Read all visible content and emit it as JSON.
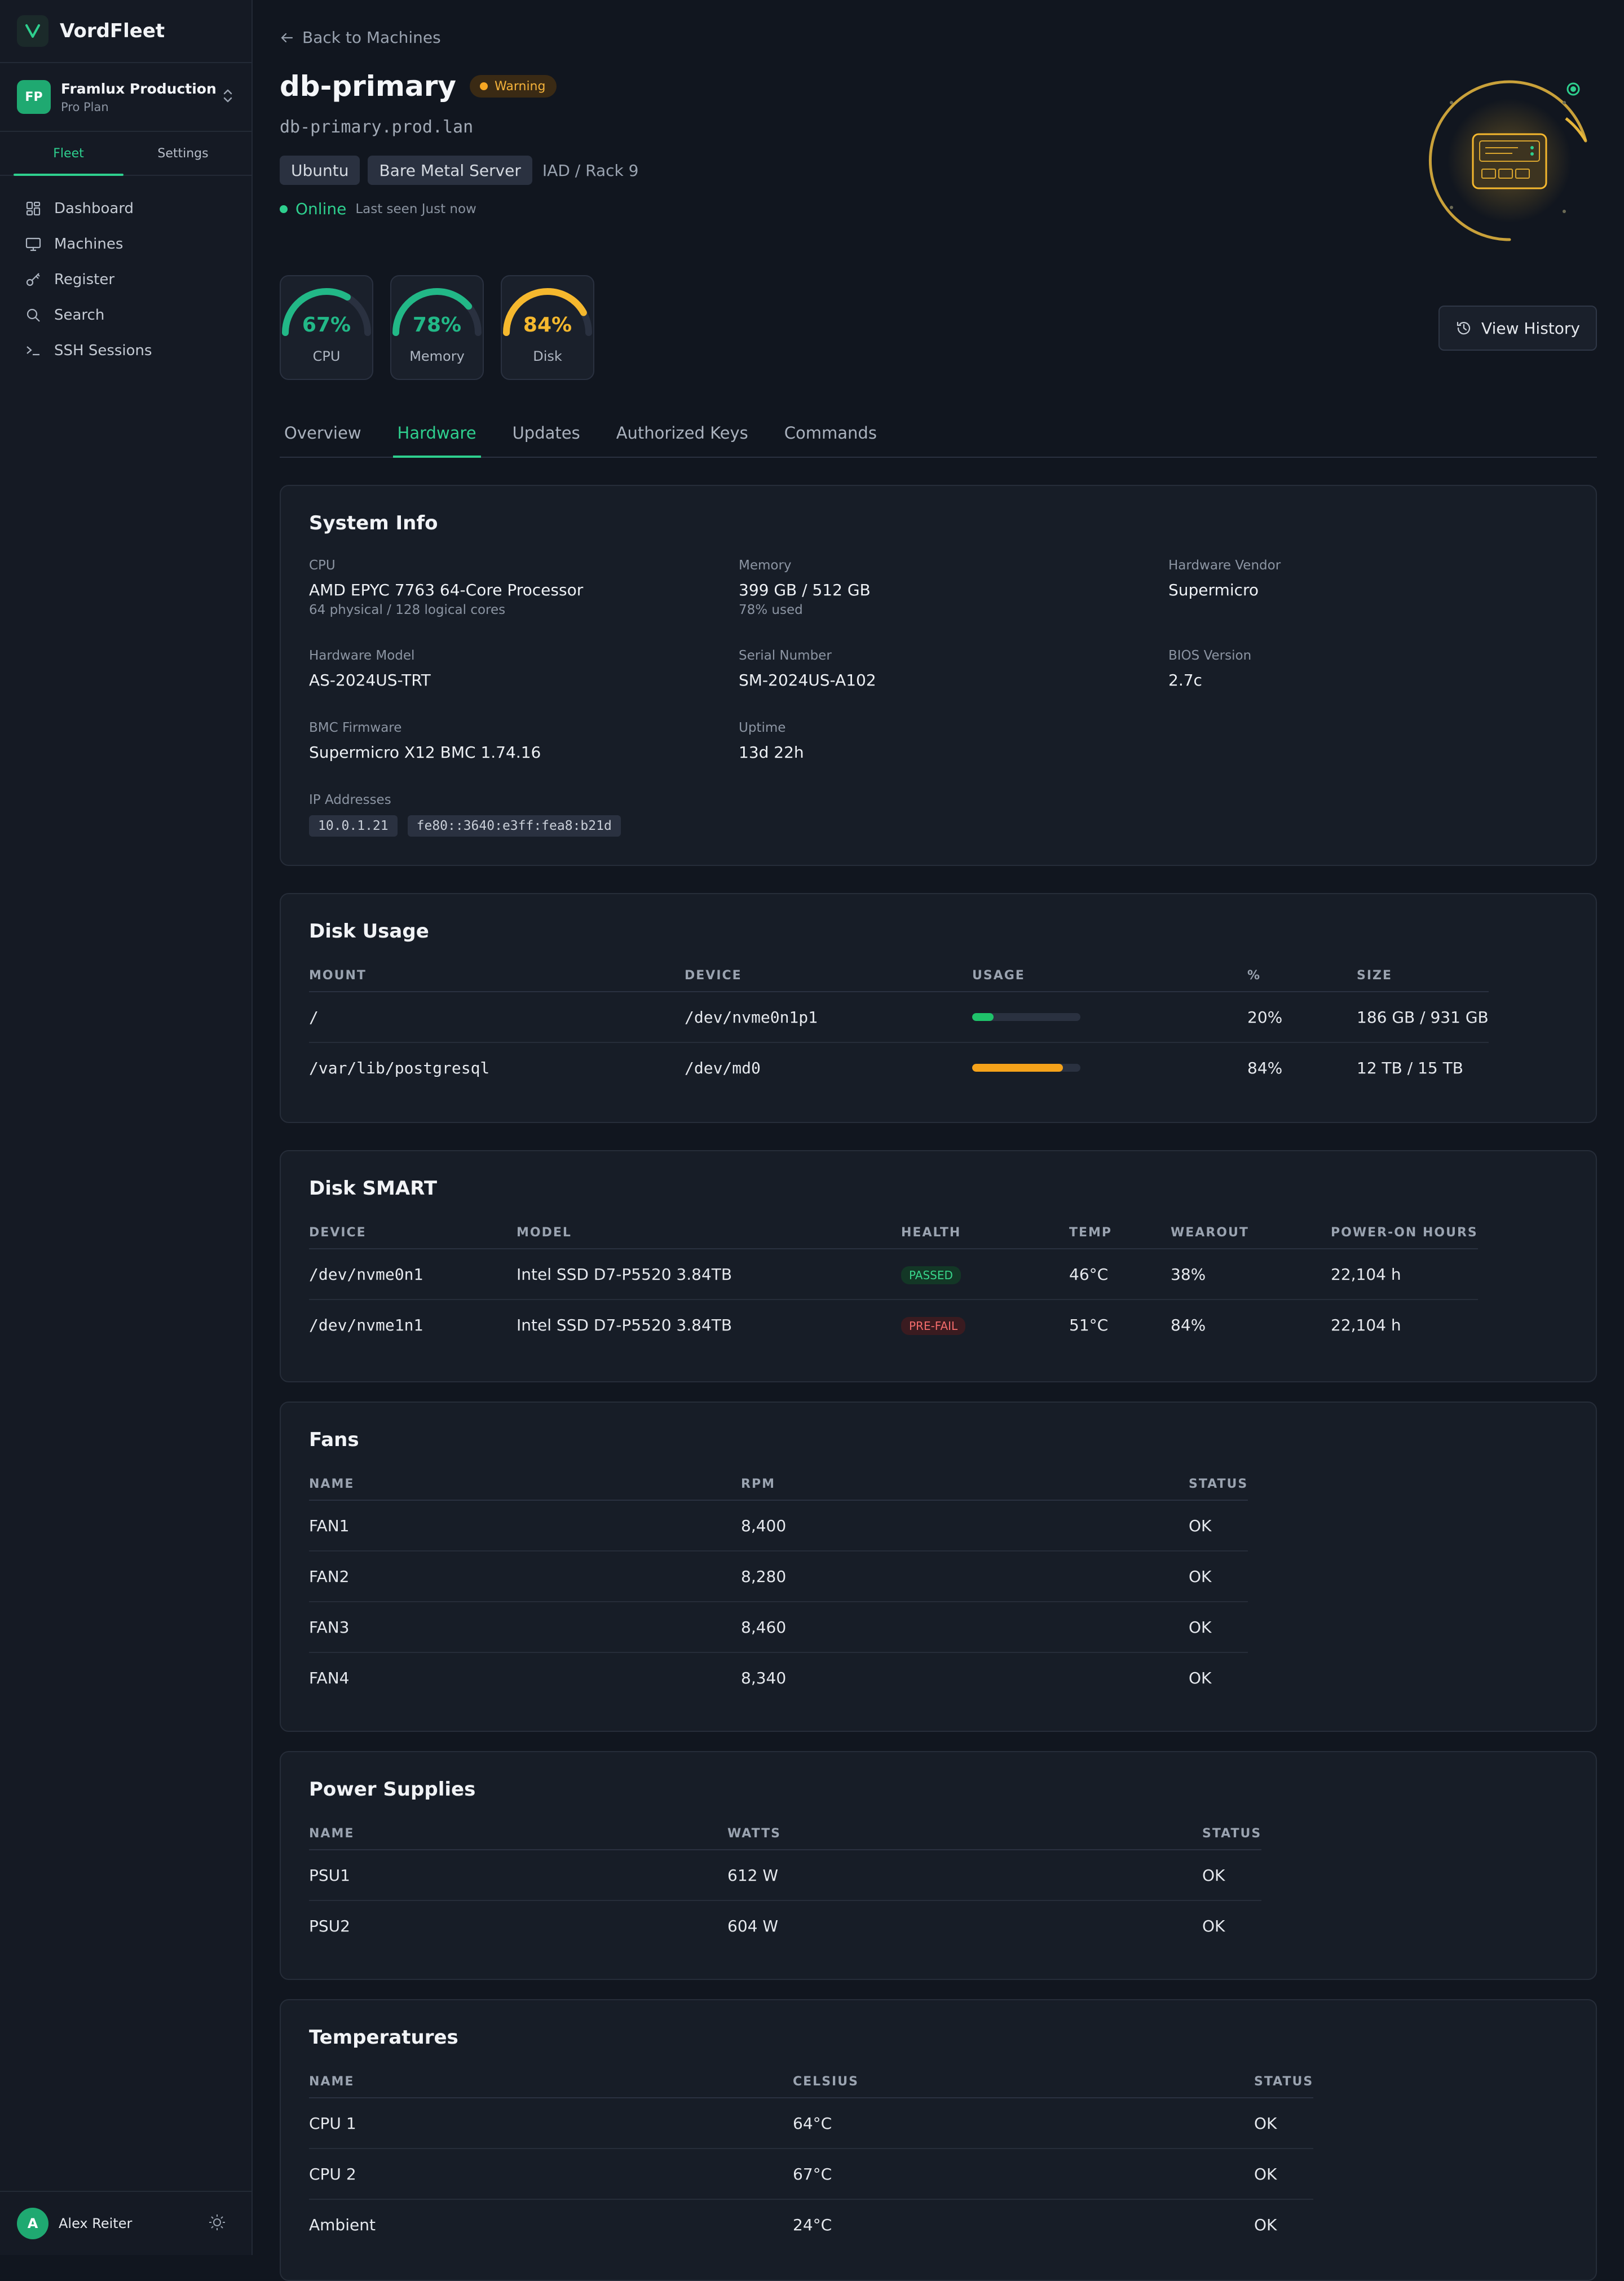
{
  "app": {
    "name": "VordFleet"
  },
  "org": {
    "initials": "FP",
    "name": "Framlux Production",
    "plan": "Pro Plan"
  },
  "sidebar": {
    "tabs": [
      {
        "label": "Fleet"
      },
      {
        "label": "Settings"
      }
    ],
    "items": [
      {
        "label": "Dashboard",
        "icon": "dashboard-icon"
      },
      {
        "label": "Machines",
        "icon": "monitor-icon"
      },
      {
        "label": "Register",
        "icon": "key-icon"
      },
      {
        "label": "Search",
        "icon": "search-icon"
      },
      {
        "label": "SSH Sessions",
        "icon": "terminal-icon"
      }
    ]
  },
  "user": {
    "initial": "A",
    "name": "Alex Reiter"
  },
  "header": {
    "back_label": "Back to Machines",
    "title": "db-primary",
    "status_badge": "Warning",
    "hostname": "db-primary.prod.lan",
    "chips": [
      "Ubuntu",
      "Bare Metal Server"
    ],
    "location": "IAD / Rack 9",
    "online": "Online",
    "last_seen": "Last seen Just now",
    "history_label": "View History"
  },
  "gauges": [
    {
      "value": "67%",
      "label": "CPU",
      "percent": 67,
      "color": "#22b887"
    },
    {
      "value": "78%",
      "label": "Memory",
      "percent": 78,
      "color": "#22b887"
    },
    {
      "value": "84%",
      "label": "Disk",
      "percent": 84,
      "color": "#f5b82e"
    }
  ],
  "tabs": [
    "Overview",
    "Hardware",
    "Updates",
    "Authorized Keys",
    "Commands"
  ],
  "active_tab": "Hardware",
  "system_info": {
    "title": "System Info",
    "cpu_label": "CPU",
    "cpu_value": "AMD EPYC 7763 64-Core Processor",
    "cpu_sub": "64 physical / 128 logical cores",
    "memory_label": "Memory",
    "memory_value": "399 GB / 512 GB",
    "memory_sub": "78% used",
    "vendor_label": "Hardware Vendor",
    "vendor_value": "Supermicro",
    "model_label": "Hardware Model",
    "model_value": "AS-2024US-TRT",
    "serial_label": "Serial Number",
    "serial_value": "SM-2024US-A102",
    "bios_label": "BIOS Version",
    "bios_value": "2.7c",
    "bmc_label": "BMC Firmware",
    "bmc_value": "Supermicro X12 BMC 1.74.16",
    "uptime_label": "Uptime",
    "uptime_value": "13d 22h",
    "ip_label": "IP Addresses",
    "ips": [
      "10.0.1.21",
      "fe80::3640:e3ff:fea8:b21d"
    ]
  },
  "disk_usage": {
    "title": "Disk Usage",
    "headers": [
      "MOUNT",
      "DEVICE",
      "USAGE",
      "%",
      "SIZE"
    ],
    "rows": [
      {
        "mount": "/",
        "device": "/dev/nvme0n1p1",
        "percent": "20%",
        "fill": 0.2,
        "color": "#1fc26a",
        "size": "186 GB / 931 GB"
      },
      {
        "mount": "/var/lib/postgresql",
        "device": "/dev/md0",
        "percent": "84%",
        "fill": 0.84,
        "color": "#f5a21a",
        "size": "12 TB / 15 TB"
      }
    ]
  },
  "disk_smart": {
    "title": "Disk SMART",
    "headers": [
      "DEVICE",
      "MODEL",
      "HEALTH",
      "TEMP",
      "WEAROUT",
      "POWER-ON HOURS"
    ],
    "rows": [
      {
        "device": "/dev/nvme0n1",
        "model": "Intel SSD D7-P5520 3.84TB",
        "health": "PASSED",
        "temp": "46°C",
        "wearout": "38%",
        "hours": "22,104 h"
      },
      {
        "device": "/dev/nvme1n1",
        "model": "Intel SSD D7-P5520 3.84TB",
        "health": "PRE-FAIL",
        "temp": "51°C",
        "wearout": "84%",
        "hours": "22,104 h"
      }
    ]
  },
  "fans": {
    "title": "Fans",
    "headers": [
      "NAME",
      "RPM",
      "STATUS"
    ],
    "rows": [
      {
        "name": "FAN1",
        "value": "8,400",
        "status": "OK"
      },
      {
        "name": "FAN2",
        "value": "8,280",
        "status": "OK"
      },
      {
        "name": "FAN3",
        "value": "8,460",
        "status": "OK"
      },
      {
        "name": "FAN4",
        "value": "8,340",
        "status": "OK"
      }
    ]
  },
  "power": {
    "title": "Power Supplies",
    "headers": [
      "NAME",
      "WATTS",
      "STATUS"
    ],
    "rows": [
      {
        "name": "PSU1",
        "value": "612 W",
        "status": "OK"
      },
      {
        "name": "PSU2",
        "value": "604 W",
        "status": "OK"
      }
    ]
  },
  "temps": {
    "title": "Temperatures",
    "headers": [
      "NAME",
      "CELSIUS",
      "STATUS"
    ],
    "rows": [
      {
        "name": "CPU 1",
        "value": "64°C",
        "status": "OK"
      },
      {
        "name": "CPU 2",
        "value": "67°C",
        "status": "OK"
      },
      {
        "name": "Ambient",
        "value": "24°C",
        "status": "OK"
      }
    ]
  }
}
